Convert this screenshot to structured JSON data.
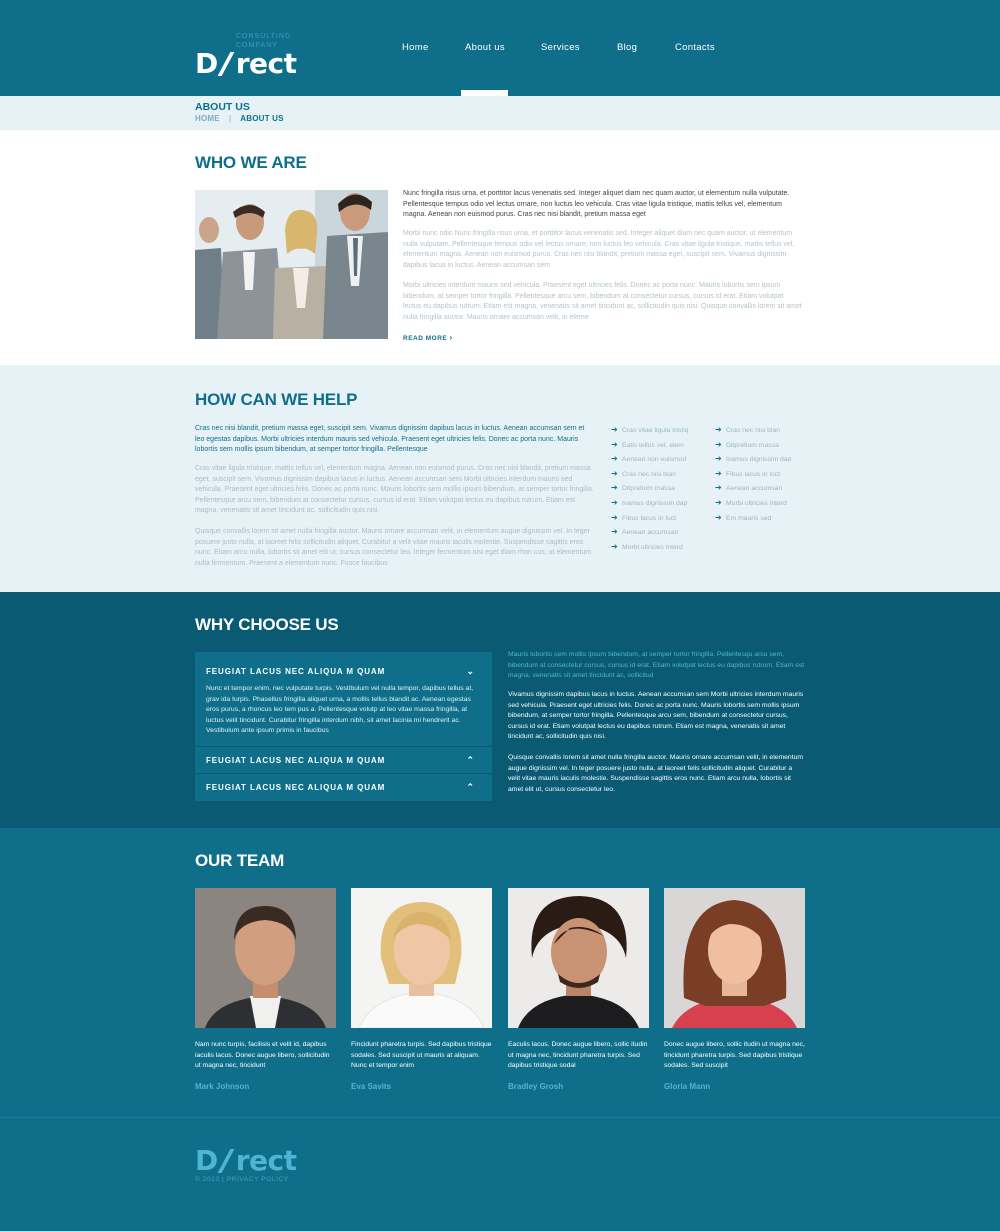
{
  "header": {
    "logo_tag_1": "CONSULTING",
    "logo_tag_2": "COMPANY",
    "logo_d": "D",
    "logo_rest": "rect",
    "nav": [
      "Home",
      "About us",
      "Services",
      "Blog",
      "Contacts"
    ],
    "active_nav": "About us"
  },
  "breadcrumb": {
    "title": "ABOUT US",
    "home": "HOME",
    "separator": "|",
    "current": "ABOUT US"
  },
  "who": {
    "title": "WHO WE ARE",
    "p1": "Nunc fringilla risus urna, et porttitor lacus venenatis sed. Integer aliquet diam nec quam auctor, ut elementum nulla vulputate. Pellentesque tempus odio vel lectus ornare, non luctus leo vehicula. Cras vitae ligula tristique, mattis tellus vel, elementum magna. Aenean non euismod purus. Cras nec nisi blandit, pretium massa eget",
    "p2": "Morbi nunc odio Nunc fringilla risus urna, et porttitor lacus venenatis sed. Integer aliquet diam nec quam auctor, ut elementum nulla vulputate. Pellentesque tempus odio vel lectus ornare, non luctus leo vehicula. Cras vitae ligula tristique, mattis tellus vel, elementum magna. Aenean non euismod purus. Cras nec nisi blandit, pretium massa eget, suscipit sem. Vivamus dignissim dapibus lacus in luctus. Aenean accumsan sem",
    "p3": "Morbi ultricies interdum mauris sed vehicula. Praesent eget ultricies felis. Donec ac porta nunc. Mauris lobortis sem ipsum bibendum, at semper tortor fringilla. Pellentesque arcu sem, bibendum at consectetur cursus, cursus id erat. Etiam volutpat lectus eu dapibus rutrum. Etiam est magna, venenatis sit amet tincidunt ac, sollicitudin quis nisi. Quisque convallis lorem sit amet nulla fringilla auctor. Mauris ornare accumsan velit, in eleme",
    "read_more": "READ MORE",
    "read_more_icon": "chevron-right-icon"
  },
  "help": {
    "title": "HOW CAN WE HELP",
    "lead": "Cras nec nisi blandit, pretium massa eget, suscipit sem. Vivamus dignissim dapibus lacus in luctus. Aenean accumsan sem et leo egestas dapibus. Morbi ultricies interdum mauris sed vehicula. Praesent eget ultricies felis. Donec ac porta nunc. Mauris lobortis sem mollis ipsum bibendum, at semper tortor fringilla. Pellentesque",
    "p1": "Cras vitae ligula tristique, mattis tellus vel, elementum magna. Aenean non euismod purus. Cras nec nisi blandit, pretium massa eget, suscipit sem. Vivamus dignissim dapibus lacus in luctus. Aenean accumsan sem Morbi ultricies interdum mauris sed vehicula. Praesent eget ultricies felis. Donec ac porta nunc. Mauris lobortis sem mollis ipsum bibendum, at semper tortor fringilla. Pellentesque arcu sem, bibendum at consectetur cursus, cursus id erat. Etiam volutpat lectus eu dapibus rutrum. Etiam est magna, venenatis sit amet tincidunt ac, sollicitudin quis nisi.",
    "p2": "Quisque convallis lorem sit amet nulla fringilla auctor. Mauris ornare accumsan velit, in elementum augue dignissim vel. In teger posuere justo nulla, at laoreet felis sollicitudin aliquet. Curabitur a velit vitae mauris iaculis molestie. Suspendisse sagittis eros nunc. Etiam arcu nulla, lobortis sit amet elit ut, cursus consectetur leo. Integer fermentum nisi eget diam rhon cus, ut elementum nulla fermentum. Praesent a elementum nunc. Fusce faucibus",
    "list_icon": "arrow-right-icon",
    "list1": [
      "Cras vitae ligula tristiq",
      "Eatis tellus vel, elem",
      "Aenean non euismod",
      "Cras nec nisi blan",
      "Ditpretium massa",
      "Ivamus dignissim dap",
      "Fibus lacus in luct",
      "Aenean accumsan",
      "Morbi ultricies interd"
    ],
    "list2": [
      "Cras nec nisi blan",
      "Ditpretium massa",
      "Ivamus dignissim dap",
      "Fibus lacus in luct",
      "Aenean accumsan",
      "Morbi ultricies interd",
      "Em mauris sed"
    ]
  },
  "why": {
    "title": "WHY CHOOSE US",
    "acc": [
      {
        "title": "FEUGIAT LACUS NEC ALIQUA M QUAM",
        "icon": "chevron-down-icon",
        "body": "Nunc et tempor enim, nec vulputate turpis. Vestibulum vel nulla tempor, dapibus tellus at, grav ida turpis. Phasellus fringilla aliquet urna, a mollis tellus blandit ac. Aenean egestas eros purus, a rhoncus leo tem pus a. Pellentesque volutp at leo vitae massa fringilla, at luctus velit tincidunt. Curabitur fringilla interdum nibh, sit amet lacinia mi hendrerit ac. Vestibulum ante ipsum primis in faucibus"
      },
      {
        "title": "FEUGIAT LACUS NEC ALIQUA M QUAM",
        "icon": "chevron-up-icon"
      },
      {
        "title": "FEUGIAT LACUS NEC ALIQUA M QUAM",
        "icon": "chevron-up-icon"
      }
    ],
    "t1": "Mauris lobortis sem mollis ipsum bibendum, at semper tortor fringilla. Pellentesqu arcu sem, bibendum at consectetur cursus, cursus id erat. Etiam volutpat lectus eu dapibus rutrum. Etiam est magna, venenatis sit amet tincidunt ac, sollicitud",
    "t2": "Vivamus dignissim dapibus lacus in luctus. Aenean accumsan sem Morbi ultricies interdum mauris sed vehicula. Praesent eget ultricies felis. Donec ac porta nunc. Mauris lobortis sem mollis ipsum bibendum, at semper tortor fringilla. Pellentesque arcu sem, bibendum at consectetur cursus, cursus id erat. Etiam volutpat lectus eu dapibus rutrum. Etiam est magna, venenatis sit amet tincidunt ac, sollicitudin quis nisi.",
    "t3": "Quisque convallis lorem sit amet nulla fringilla auctor. Mauris ornare accumsan velit, in elementum augue dignissim vel. In teger posuere justo nulla, at laoreet felis sollicitudin aliquet. Curabitur a velit vitae mauris iaculis molestie. Suspendisse sagittis eros nunc. Etiam arcu nulla, lobortis sit amet elit ut, cursus consectetur leo."
  },
  "team": {
    "title": "OUR TEAM",
    "members": [
      {
        "name": "Mark Johnson",
        "text": "Nam nunc turpis, facilisis et velit id, dapibus iaculis lacus. Donec augue libero, sollicitudin ut magna nec, tincidunt"
      },
      {
        "name": "Eva Savits",
        "text": "Fincidunt pharetra turpis. Sed dapibus tristique sodales. Sed suscipit ut mauris at aliquam. Nunc et tempor enim"
      },
      {
        "name": "Bradley Grosh",
        "text": "Eaculis lacus. Donec augue libero, sollic itudin ut magna nec, tincidunt pharetra turpis. Sed dapibus tristique sodal"
      },
      {
        "name": "Gloria Mann",
        "text": "Donec augue libero, sollic itudin ut magna nec, tincidunt pharetra turpis. Sed dapibus tristique sodales. Sed suscipit"
      }
    ]
  },
  "footer": {
    "logo_d": "D",
    "logo_rest": "rect",
    "copyright": "© 2013 | PRIVACY POLICY"
  },
  "colors": {
    "brand": "#0f6f8b",
    "dark": "#0a5a73",
    "accent": "#4fb5d4",
    "light_band": "#e7f2f7"
  }
}
